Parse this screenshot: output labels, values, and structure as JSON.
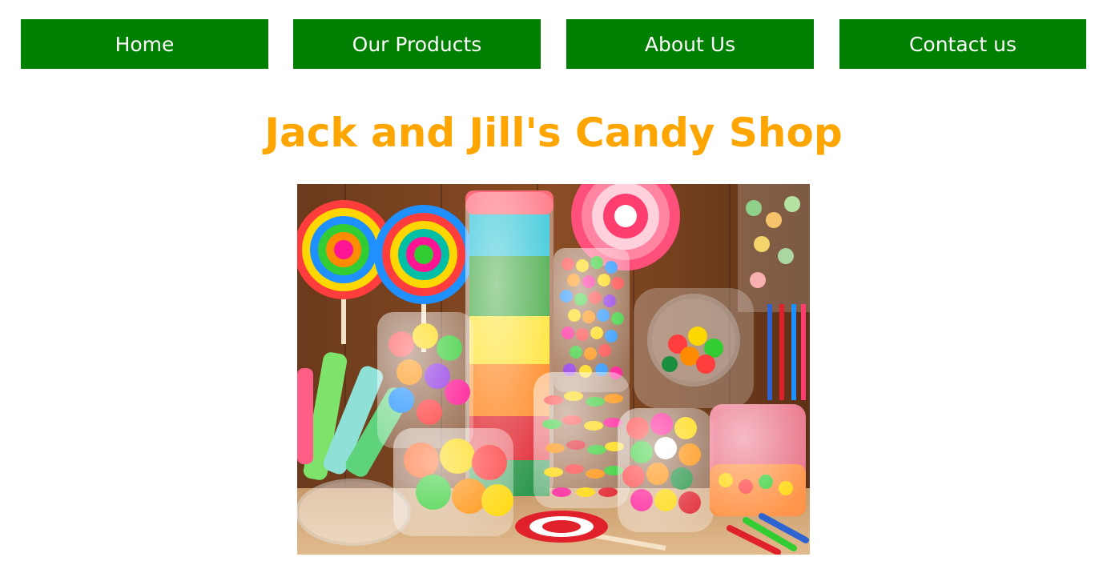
{
  "nav": {
    "items": [
      {
        "label": "Home"
      },
      {
        "label": "Our Products"
      },
      {
        "label": "About Us"
      },
      {
        "label": "Contact us"
      }
    ],
    "color": "#008000",
    "text_color": "#ffffff"
  },
  "header": {
    "title": "Jack and Jill's Candy Shop",
    "title_color": "#ffa500"
  },
  "hero": {
    "image": "candy-jars-photo"
  }
}
